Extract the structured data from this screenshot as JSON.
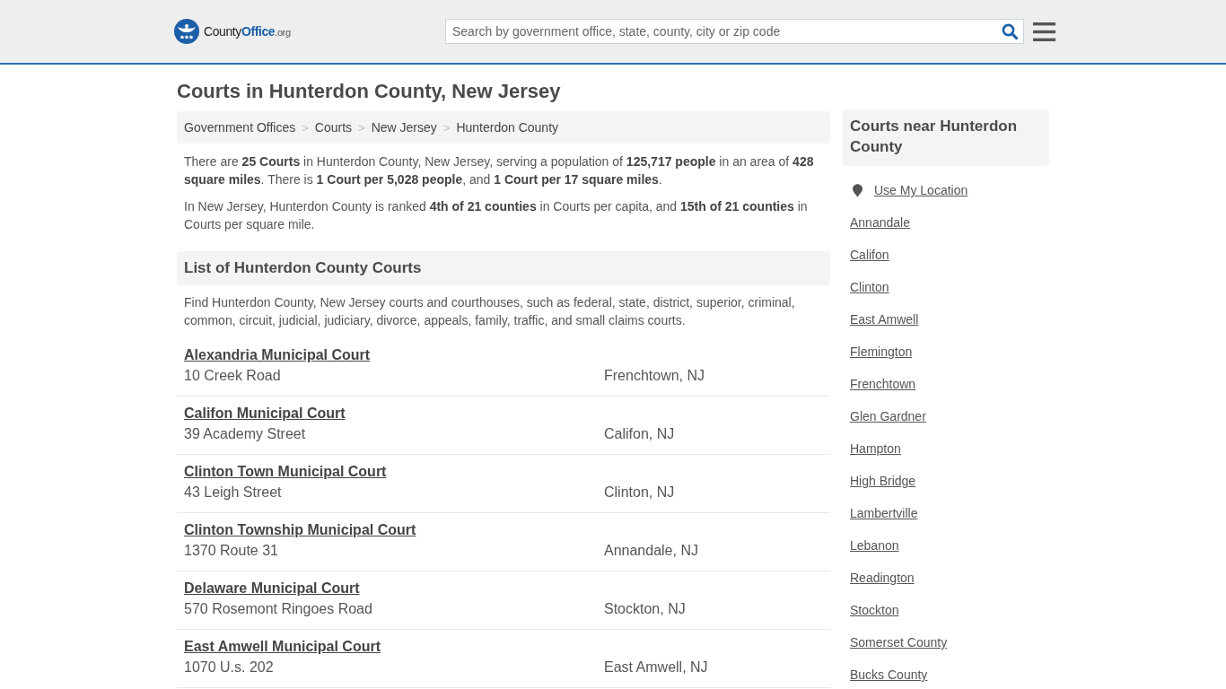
{
  "header": {
    "logo": {
      "name": "County",
      "highlight": "Office",
      "suffix": ".org"
    },
    "search": {
      "placeholder": "Search by government office, state, county, city or zip code"
    }
  },
  "page_title": "Courts in Hunterdon County, New Jersey",
  "breadcrumb": [
    {
      "label": "Government Offices"
    },
    {
      "separator": ">",
      "label": "Courts"
    },
    {
      "separator": ">",
      "label": "New Jersey"
    },
    {
      "separator": ">",
      "label": "Hunterdon County"
    }
  ],
  "summary": [
    "There are **25 Courts** in Hunterdon County, New Jersey, serving a population of **125,717 people** in an area of **428 square miles**. There is **1 Court per 5,028 people**, and **1 Court per 17 square miles**.",
    "In New Jersey, Hunterdon County is ranked **4th of 21 counties** in Courts per capita, and **15th of 21 counties** in Courts per square mile."
  ],
  "list_section": {
    "heading": "List of Hunterdon County Courts",
    "description": "Find Hunterdon County, New Jersey courts and courthouses, such as federal, state, district, superior, criminal, common, circuit, judicial, judiciary, divorce, appeals, family, traffic, and small claims courts.",
    "courts": [
      {
        "name": "Alexandria Municipal Court",
        "address": "10 Creek Road",
        "city": "Frenchtown, NJ"
      },
      {
        "name": "Califon Municipal Court",
        "address": "39 Academy Street",
        "city": "Califon, NJ"
      },
      {
        "name": "Clinton Town Municipal Court",
        "address": "43 Leigh Street",
        "city": "Clinton, NJ"
      },
      {
        "name": "Clinton Township Municipal Court",
        "address": "1370 Route 31",
        "city": "Annandale, NJ"
      },
      {
        "name": "Delaware Municipal Court",
        "address": "570 Rosemont Ringoes Road",
        "city": "Stockton, NJ"
      },
      {
        "name": "East Amwell Municipal Court",
        "address": "1070 U.s. 202",
        "city": "East Amwell, NJ"
      }
    ]
  },
  "sidebar": {
    "heading": "Courts near Hunterdon County",
    "location_link": "Use My Location",
    "links": [
      "Annandale",
      "Califon",
      "Clinton",
      "East Amwell",
      "Flemington",
      "Frenchtown",
      "Glen Gardner",
      "Hampton",
      "High Bridge",
      "Lambertville",
      "Lebanon",
      "Readington",
      "Stockton",
      "Somerset County",
      "Bucks County"
    ]
  }
}
